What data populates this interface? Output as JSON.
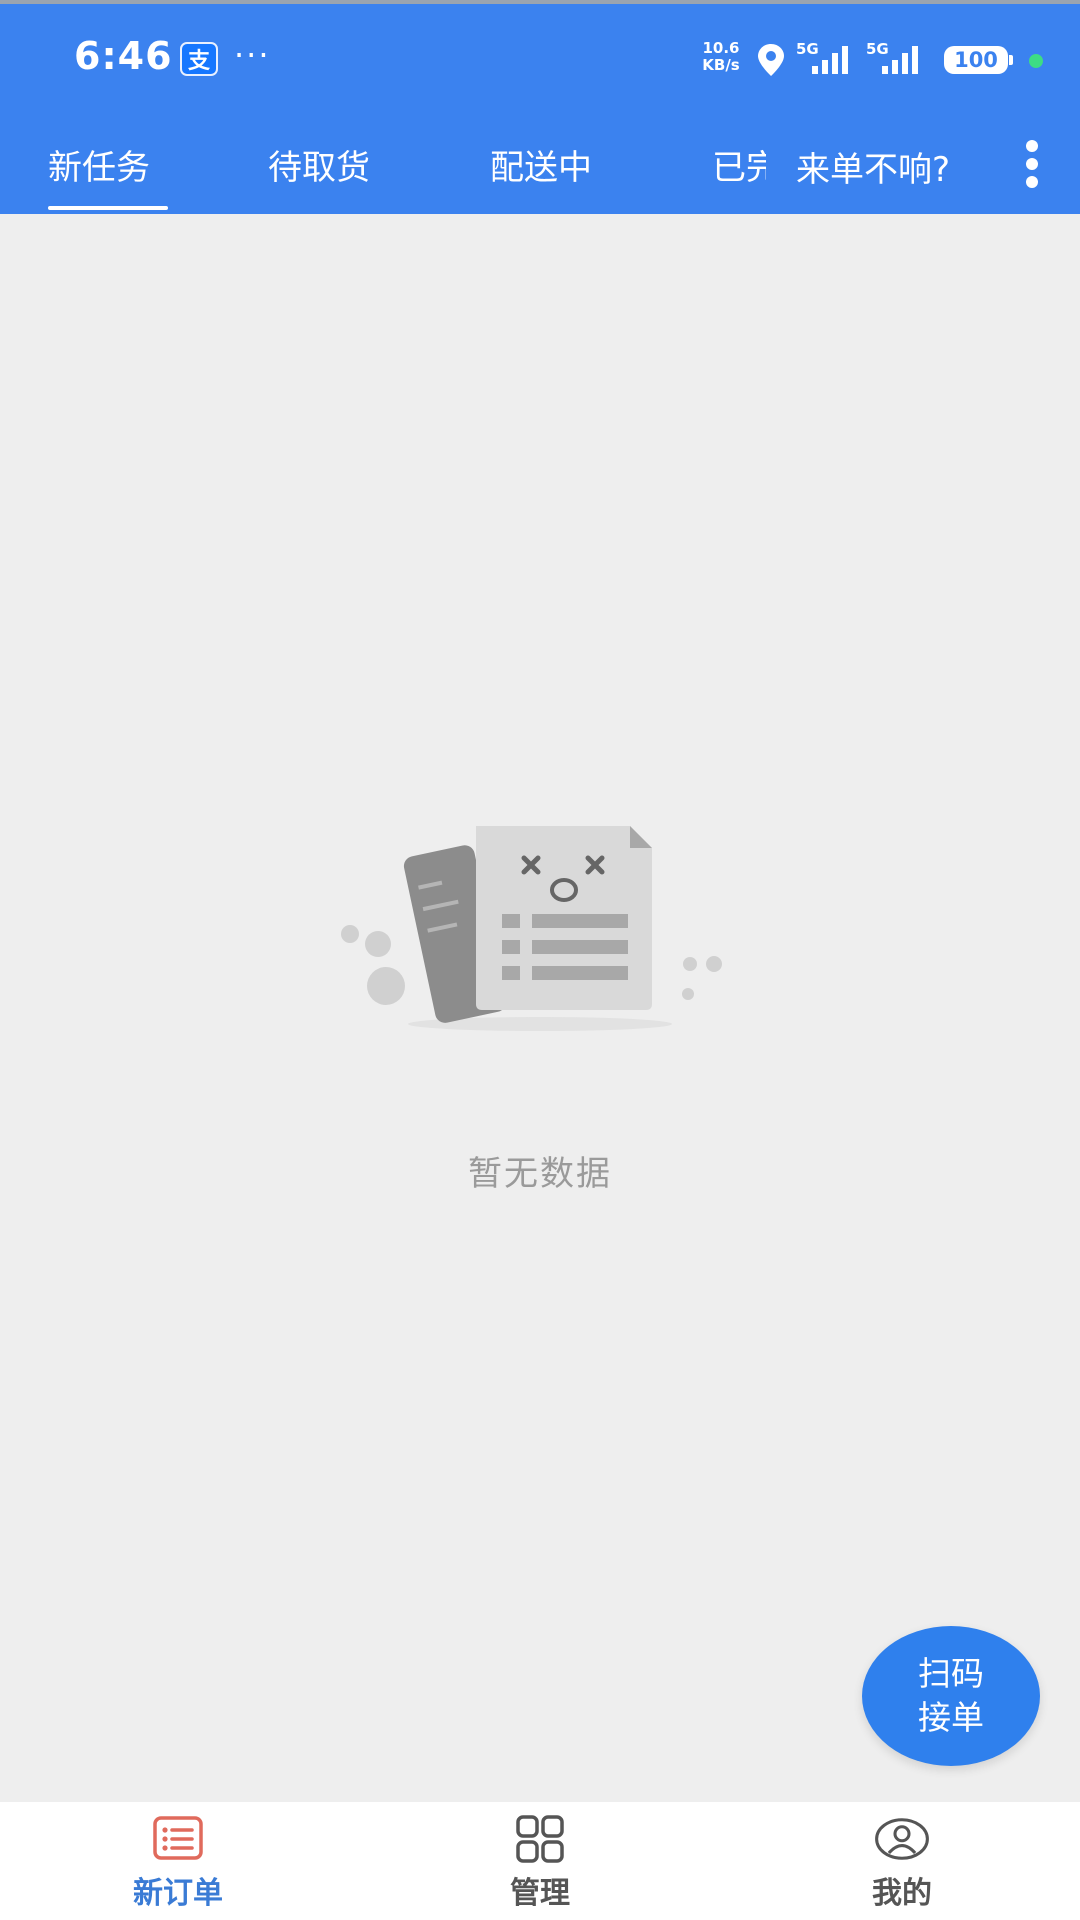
{
  "status_bar": {
    "time": "6:46",
    "alipay_icon": "支",
    "more": "···",
    "net_speed_value": "10.6",
    "net_speed_unit": "KB/s",
    "signal_1": "5G",
    "signal_2": "5G",
    "battery": "100"
  },
  "tabs": [
    {
      "label": "新任务",
      "active": true
    },
    {
      "label": "待取货"
    },
    {
      "label": "配送中"
    },
    {
      "label": "已完成"
    }
  ],
  "header_link": "来单不响?",
  "empty_text": "暂无数据",
  "fab": {
    "line1": "扫码",
    "line2": "接单"
  },
  "bottom_nav": [
    {
      "label": "新订单",
      "icon": "order-list-icon",
      "active": true
    },
    {
      "label": "管理",
      "icon": "grid-icon"
    },
    {
      "label": "我的",
      "icon": "user-icon"
    }
  ],
  "colors": {
    "primary": "#3b82ef",
    "fab": "#2f80ed",
    "background": "#eeeeee",
    "active_nav": "#3a7bd5"
  }
}
